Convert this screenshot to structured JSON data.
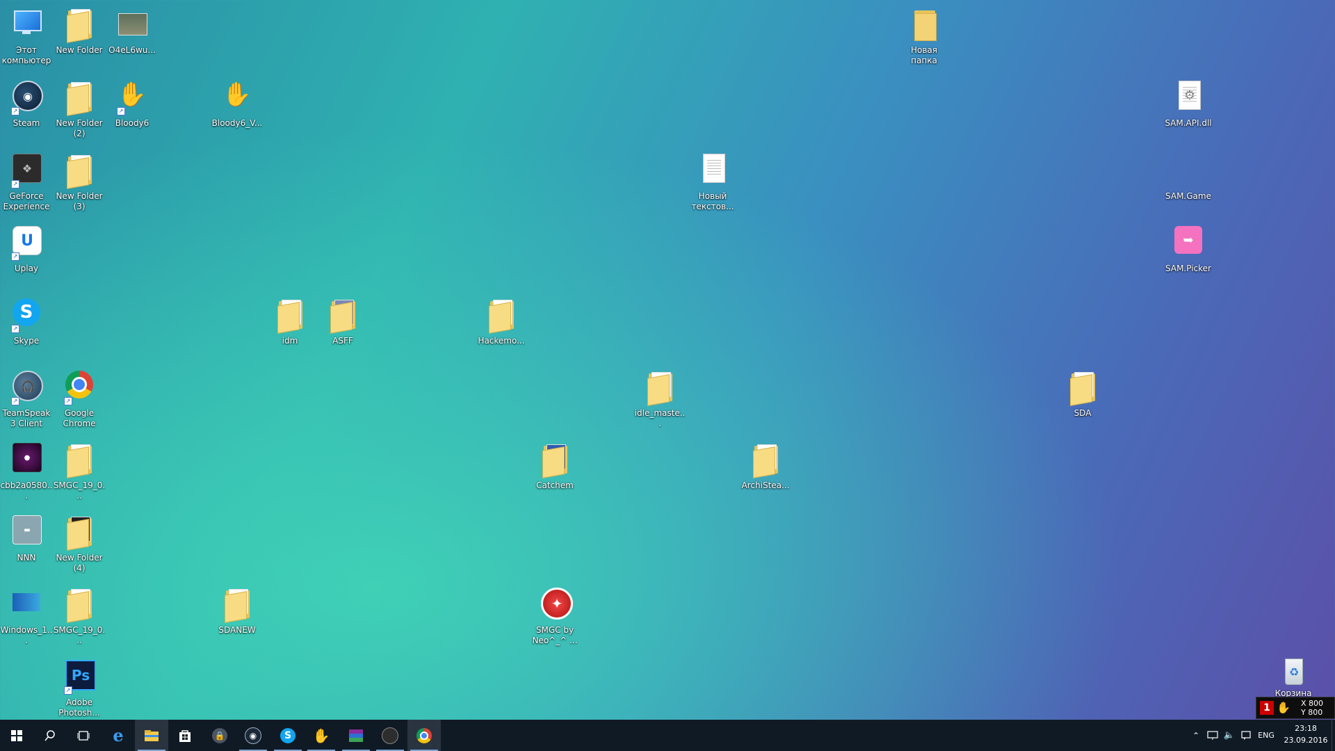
{
  "desktop_icons": [
    {
      "label": "Этот компьютер"
    },
    {
      "label": "Steam"
    },
    {
      "label": "GeForce Experience"
    },
    {
      "label": "Uplay"
    },
    {
      "label": "Skype"
    },
    {
      "label": "TeamSpeak 3 Client"
    },
    {
      "label": "cbb2a0580..."
    },
    {
      "label": "NNN"
    },
    {
      "label": "Windows_1..."
    },
    {
      "label": "New Folder"
    },
    {
      "label": "New Folder (2)"
    },
    {
      "label": "New Folder (3)"
    },
    {
      "label": "Google Chrome"
    },
    {
      "label": "SMGC_19_0..."
    },
    {
      "label": "New Folder (4)"
    },
    {
      "label": "SMGC_19_0..."
    },
    {
      "label": "Adobe Photosh..."
    },
    {
      "label": "O4eL6wu..."
    },
    {
      "label": "Bloody6"
    },
    {
      "label": "Bloody6_V..."
    },
    {
      "label": "idm"
    },
    {
      "label": "ASFF"
    },
    {
      "label": "SDANEW"
    },
    {
      "label": "Hackemo..."
    },
    {
      "label": "Catchem"
    },
    {
      "label": "SMGC by Neo^_^ ..."
    },
    {
      "label": "idle_maste..."
    },
    {
      "label": "Новый текстов..."
    },
    {
      "label": "ArchiStea..."
    },
    {
      "label": "Новая папка"
    },
    {
      "label": "SDA"
    },
    {
      "label": "SAM.API.dll"
    },
    {
      "label": "SAM.Game"
    },
    {
      "label": "SAM.Picker"
    },
    {
      "label": "Корзина"
    }
  ],
  "bloody_overlay": {
    "badge": "1",
    "x_readout": "X 800",
    "y_readout": "Y 800"
  },
  "taskbar": {
    "start": "Start",
    "search": "Search",
    "task_view": "Task View",
    "pinned": [
      {
        "name": "Microsoft Edge"
      },
      {
        "name": "File Explorer"
      },
      {
        "name": "Store"
      },
      {
        "name": "KeePass"
      },
      {
        "name": "Steam"
      },
      {
        "name": "Skype"
      },
      {
        "name": "Bloody"
      },
      {
        "name": "WinRAR"
      },
      {
        "name": "Unity"
      },
      {
        "name": "Google Chrome"
      }
    ],
    "tray": {
      "language": "ENG",
      "time": "23:18",
      "date": "23.09.2016"
    }
  }
}
